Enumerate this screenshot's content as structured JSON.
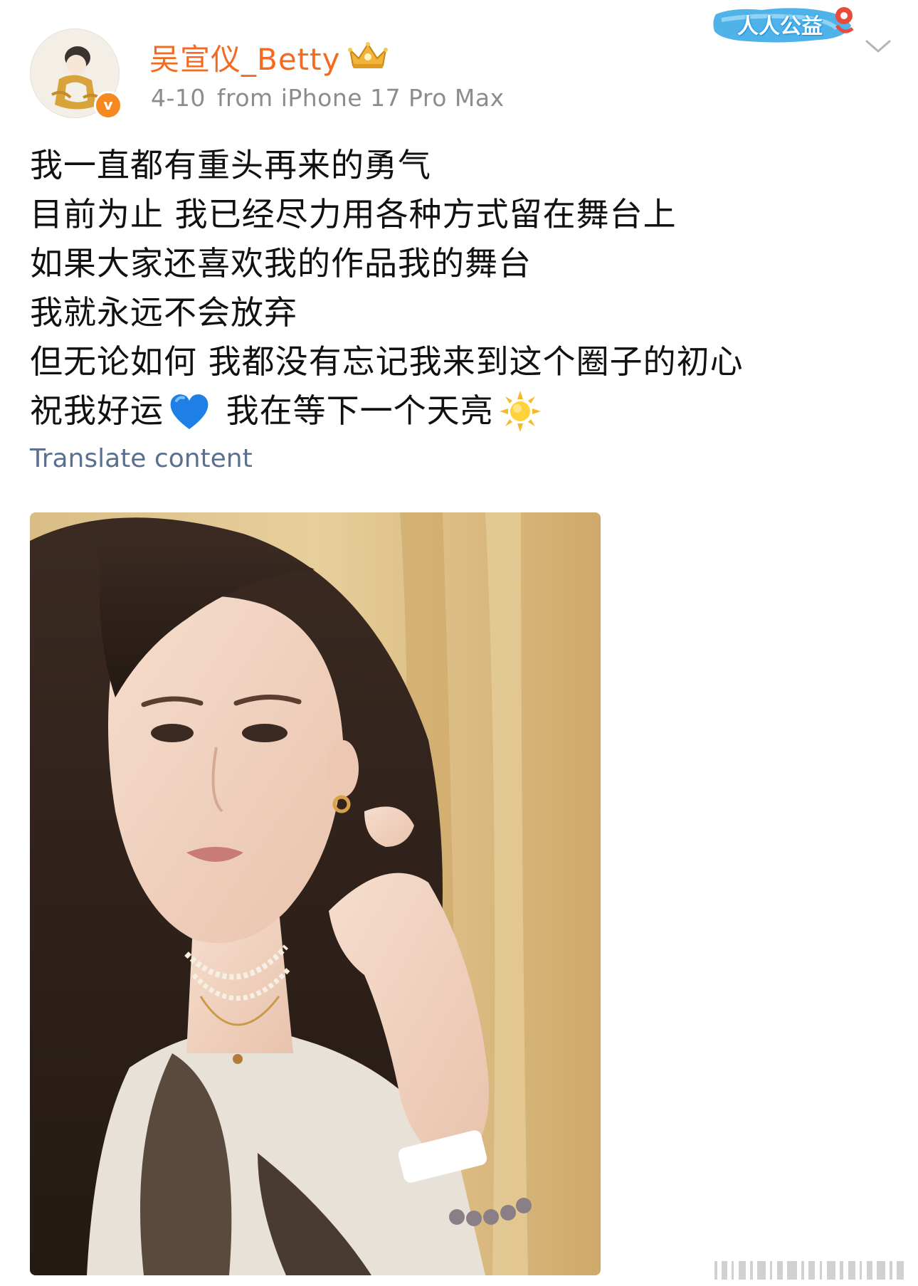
{
  "post": {
    "author": {
      "name": "吴宣仪_Betty",
      "verified_icon": "v-badge-icon",
      "crown_icon": "crown-icon",
      "date": "4-10",
      "source": "from iPhone 17 Pro Max"
    },
    "charity_badge": {
      "label": "人人公益"
    },
    "menu_icon": "chevron-down-icon",
    "text_lines": [
      "我一直都有重头再来的勇气",
      "目前为止 我已经尽力用各种方式留在舞台上",
      "如果大家还喜欢我的作品我的舞台",
      "我就永远不会放弃",
      "但无论如何 我都没有忘记我来到这个圈子的初心"
    ],
    "last_line": {
      "part1": "祝我好运",
      "part2": " 我在等下一个天亮"
    },
    "translate_label": "Translate content"
  },
  "colors": {
    "username": "#f26b21",
    "meta": "#8c8c8c",
    "translate": "#5b6f8f",
    "verified": "#f5891f"
  }
}
